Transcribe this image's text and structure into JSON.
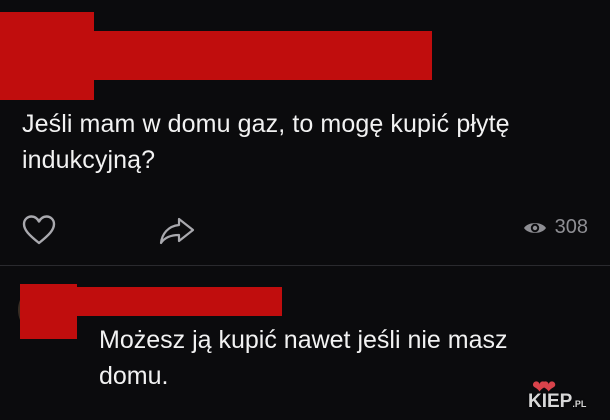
{
  "post": {
    "text": "Jeśli mam w domu gaz, to mogę kupić płytę indukcyjną?",
    "views": "308"
  },
  "comment": {
    "text": "Możesz ją kupić nawet jeśli nie masz domu."
  },
  "watermark": {
    "brand": "KIEP",
    "suffix": ".PL",
    "hearts": "❤❤"
  },
  "icons": {
    "like": "heart-icon",
    "share": "share-icon",
    "views": "eye-icon"
  },
  "colors": {
    "background": "#0b0b0d",
    "redaction": "#c00d0d",
    "muted": "#8e8e93"
  }
}
